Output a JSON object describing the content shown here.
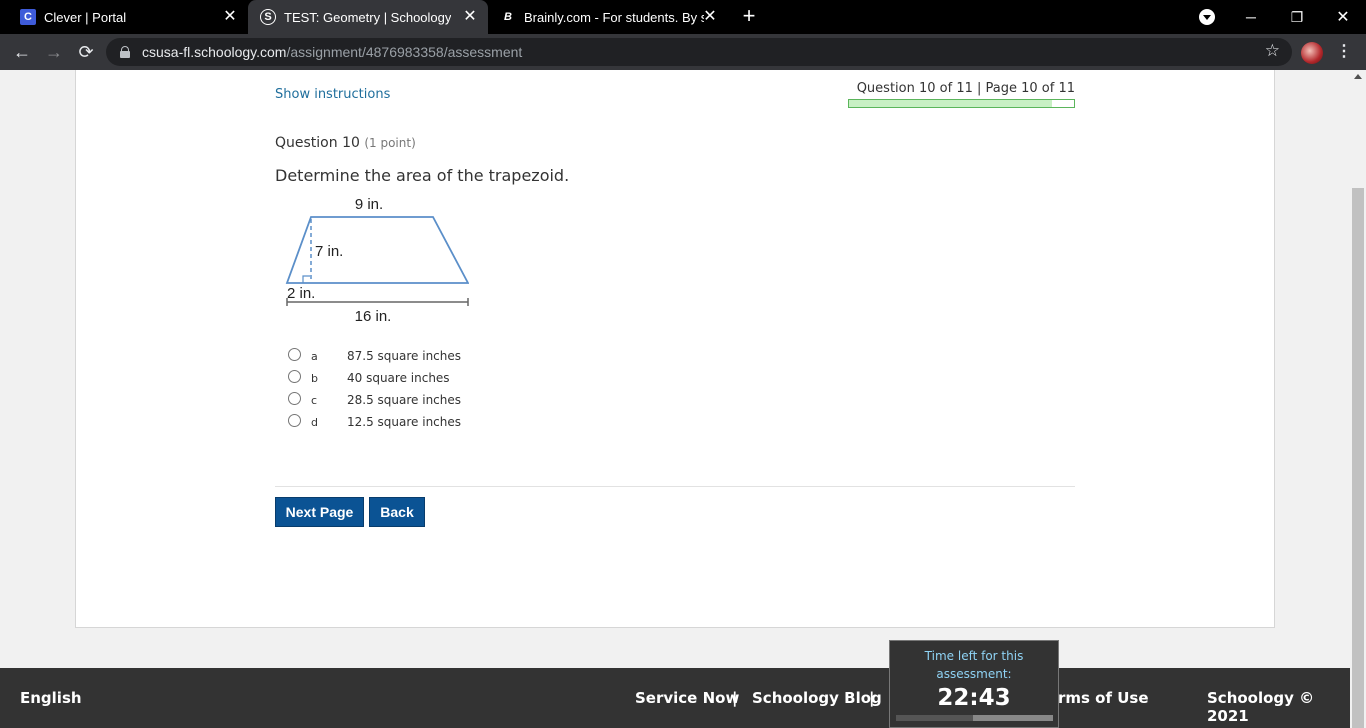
{
  "browser": {
    "tabs": [
      {
        "title": "Clever | Portal",
        "favicon": "C",
        "active": false
      },
      {
        "title": "TEST: Geometry | Schoology",
        "favicon": "S",
        "active": true
      },
      {
        "title": "Brainly.com - For students. By stu",
        "favicon": "B",
        "active": false
      }
    ],
    "new_tab": "+",
    "url_host": "csusa-fl.schoology.com",
    "url_path": "/assignment/4876983358/assessment"
  },
  "assessment": {
    "show_instructions": "Show instructions",
    "counter": "Question 10 of 11 | Page 10 of 11",
    "progress_fraction": 0.9,
    "question_label": "Question 10",
    "question_points": "(1 point)",
    "question_text": "Determine the area of the trapezoid.",
    "figure": {
      "top_label": "9 in.",
      "height_label": "7 in.",
      "offset_label": "2 in.",
      "bottom_label": "16 in."
    },
    "choices": [
      {
        "letter": "a",
        "text": "87.5 square inches"
      },
      {
        "letter": "b",
        "text": "40 square inches"
      },
      {
        "letter": "c",
        "text": "28.5 square inches"
      },
      {
        "letter": "d",
        "text": "12.5 square inches"
      }
    ],
    "next_button": "Next Page",
    "back_button": "Back"
  },
  "footer": {
    "language": "English",
    "service_now": "Service Now",
    "separator": "|",
    "blog": "Schoology Blog",
    "terms": "rms of Use",
    "copyright": "Schoology © 2021"
  },
  "timer": {
    "label": "Time left for this assessment:",
    "value": "22:43",
    "remaining_fraction": 0.49
  }
}
